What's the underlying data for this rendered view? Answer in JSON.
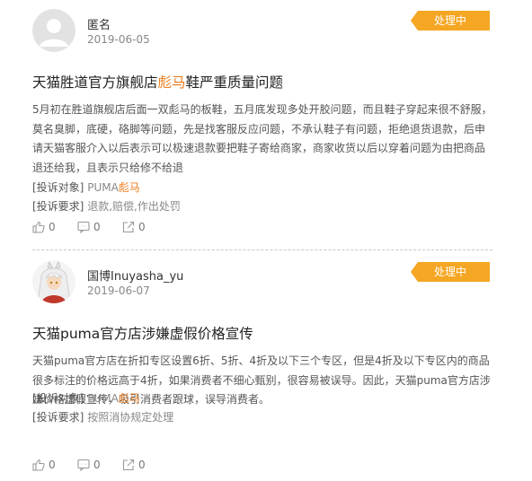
{
  "posts": [
    {
      "username": "匿名",
      "date": "2019-06-05",
      "status": "处理中",
      "title_pre": "天猫胜道官方旗舰店",
      "title_hl": "彪马",
      "title_post": "鞋严重质量问题",
      "body_lines": [
        "5月初在胜道旗舰店后面一双彪马的板鞋，五月底发现多处开胶问题，而且鞋子穿起来很不舒服，",
        "莫名臭脚，底硬，硌脚等问题，先是找客服反应问题，不承认鞋子有问题，拒绝退货退款，后申",
        "请天猫客服介入以后表示可以极速退款要把鞋子寄给商家，商家收货以后以穿着问题为由把商品",
        "退还给我，且表示只给修不给退"
      ],
      "target_label": "[投诉对象]",
      "target_pre": "PUMA",
      "target_hl": "彪马",
      "demand_label": "[投诉要求]",
      "demand_value": "退款,赔偿,作出处罚",
      "likes": "0",
      "comments": "0",
      "shares": "0"
    },
    {
      "username": "国博Inuyasha_yu",
      "date": "2019-06-07",
      "status": "处理中",
      "title_pre": "天猫puma官方店涉嫌虚假价格宣传",
      "title_hl": "",
      "title_post": "",
      "body_lines": [
        "天猫puma官方店在折扣专区设置6折、5折、4折及以下三个专区，但是4折及以下专区内的商品",
        "很多标注的价格远高于4折，如果消费者不细心甄别，很容易被误导。因此，天猫puma官方店涉",
        "嫌价格虚假宣传，吸引消费者跟球，误导消费者。"
      ],
      "target_label": "[投诉对象]",
      "target_pre": "PUMA",
      "target_hl": "彪马",
      "demand_label": "[投诉要求]",
      "demand_value": "按照消协规定处理",
      "likes": "0",
      "comments": "0",
      "shares": "0"
    }
  ],
  "colors": {
    "badge": "#f5a623",
    "highlight": "#f07d1f"
  },
  "icons": {
    "like": "thumbs-up-icon",
    "comment": "comment-icon",
    "share": "share-icon"
  }
}
